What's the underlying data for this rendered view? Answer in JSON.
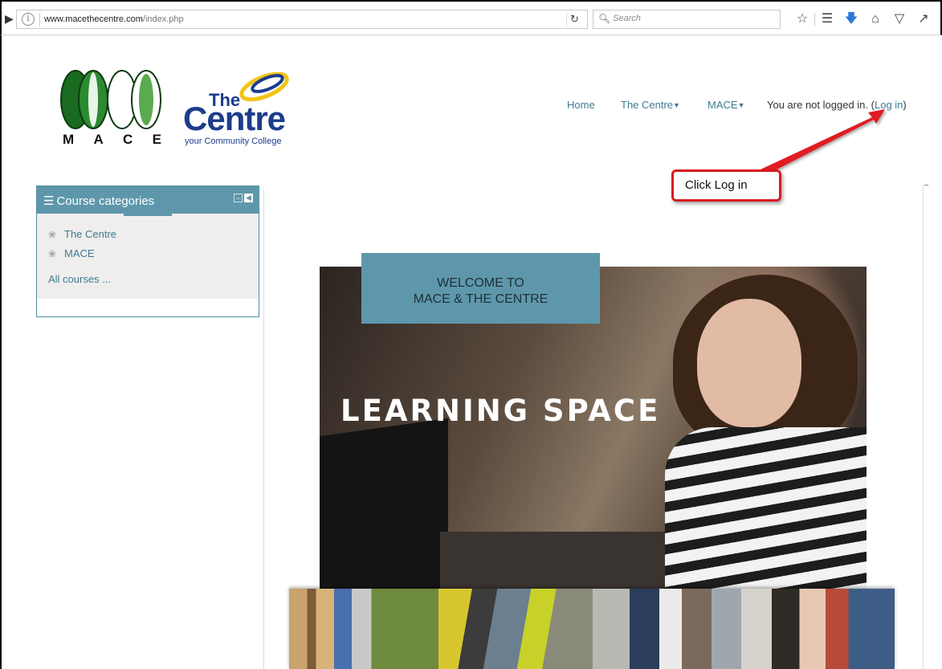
{
  "browser": {
    "url_domain": "www.macethecentre.com",
    "url_path": "/index.php",
    "search_placeholder": "Search"
  },
  "logos": {
    "mace_letters": [
      "M",
      "A",
      "C",
      "E"
    ],
    "centre_the": "The",
    "centre_main": "Centre",
    "centre_sub": "your Community College"
  },
  "nav": {
    "home": "Home",
    "the_centre": "The Centre",
    "mace": "MACE",
    "login_status": "You are not logged in.",
    "login_open": "(",
    "login_link": "Log in",
    "login_close": ")"
  },
  "annotation": {
    "callout_text": "Click Log in"
  },
  "block": {
    "title": "Course categories",
    "categories": [
      "The Centre",
      "MACE"
    ],
    "all_courses": "All courses ..."
  },
  "hero": {
    "welcome_line1": "WELCOME TO",
    "welcome_line2": "MACE & THE CENTRE",
    "title": "LEARNING SPACE"
  },
  "colors": {
    "accent": "#5e97ab",
    "link": "#3d7b92",
    "annotation_red": "#d9191f",
    "brand_blue": "#1b3d8c"
  }
}
